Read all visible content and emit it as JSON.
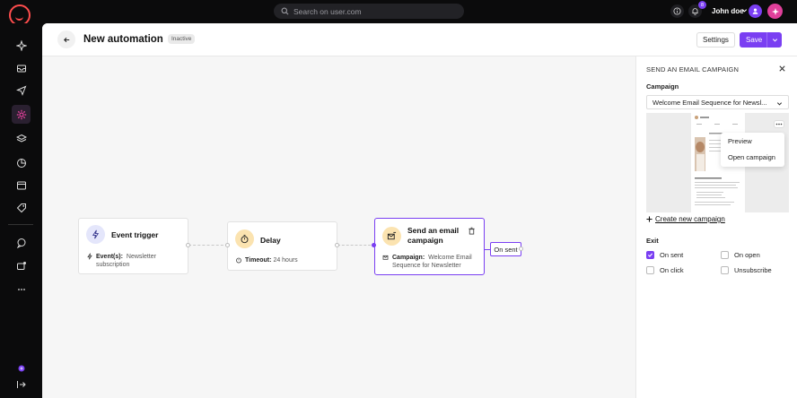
{
  "topbar": {
    "search_placeholder": "Search on user.com",
    "notification_count": "8",
    "user_name": "John doe"
  },
  "header": {
    "title": "New automation",
    "status": "Inactive",
    "settings_label": "Settings",
    "save_label": "Save"
  },
  "nodes": {
    "trigger": {
      "title": "Event trigger",
      "detail_label": "Event(s):",
      "detail_value": "Newsletter subscription"
    },
    "delay": {
      "title": "Delay",
      "detail_label": "Timeout:",
      "detail_value": "24 hours"
    },
    "email": {
      "title": "Send an email campaign",
      "detail_label": "Campaign:",
      "detail_value": "Welcome Email Sequence for Newsletter"
    },
    "on_sent": "On sent"
  },
  "panel": {
    "title": "SEND AN EMAIL CAMPAIGN",
    "campaign_label": "Campaign",
    "campaign_value": "Welcome Email Sequence for Newsl...",
    "menu": [
      "Preview",
      "Open campaign"
    ],
    "create_link": "Create new campaign",
    "exit_label": "Exit",
    "exit_options": [
      {
        "label": "On sent",
        "checked": true
      },
      {
        "label": "On open",
        "checked": false
      },
      {
        "label": "On click",
        "checked": false
      },
      {
        "label": "Unsubscribe",
        "checked": false
      }
    ]
  },
  "colors": {
    "accent": "#7a3ff2",
    "logo": "#ff4d4d",
    "ai": "#e0409a"
  }
}
